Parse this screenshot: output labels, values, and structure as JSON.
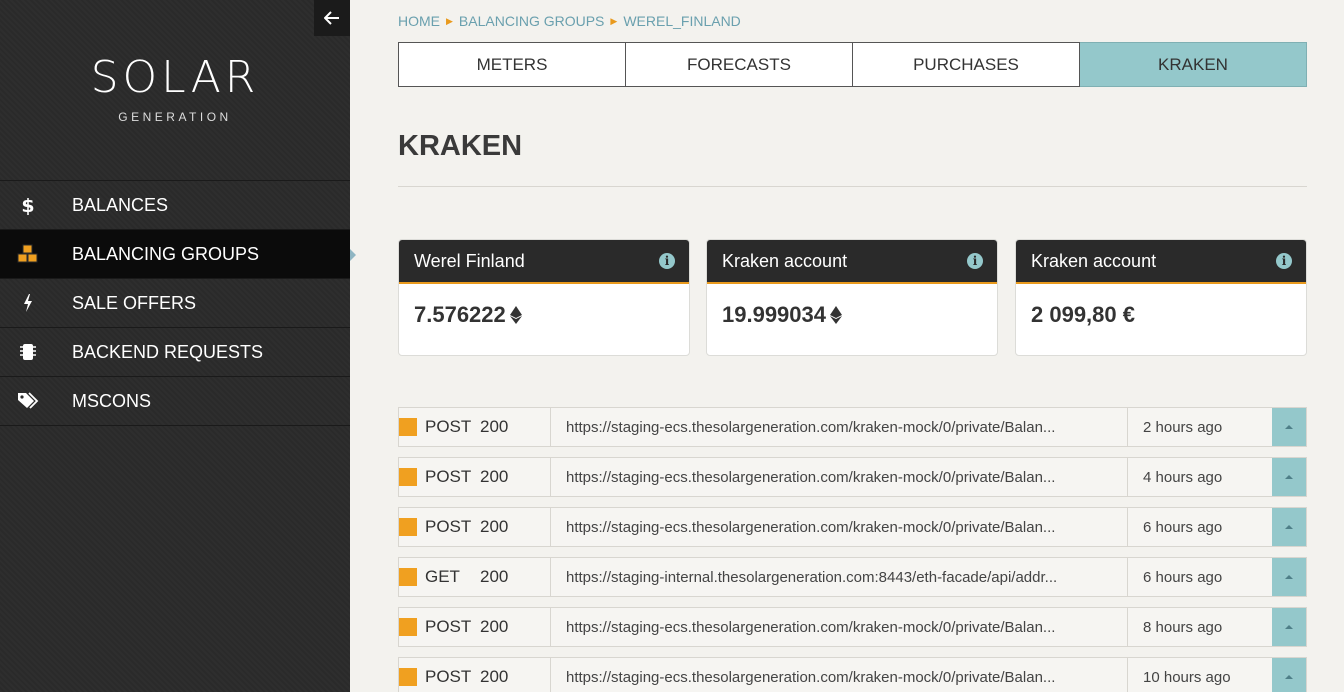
{
  "sidebar": {
    "logo_main": "SOLAR",
    "logo_sub": "GENERATION",
    "items": [
      {
        "label": "BALANCES",
        "icon": "dollar-icon"
      },
      {
        "label": "BALANCING GROUPS",
        "icon": "cubes-icon",
        "active": true
      },
      {
        "label": "SALE OFFERS",
        "icon": "bolt-icon"
      },
      {
        "label": "BACKEND REQUESTS",
        "icon": "chip-icon"
      },
      {
        "label": "MSCONS",
        "icon": "tags-icon"
      }
    ]
  },
  "breadcrumb": [
    "HOME",
    "BALANCING GROUPS",
    "WEREL_FINLAND"
  ],
  "tabs": [
    {
      "label": "METERS"
    },
    {
      "label": "FORECASTS"
    },
    {
      "label": "PURCHASES"
    },
    {
      "label": "KRAKEN",
      "active": true
    }
  ],
  "page_title": "KRAKEN",
  "cards": [
    {
      "title": "Werel Finland",
      "value": "7.576222",
      "unit_icon": "ethereum-icon"
    },
    {
      "title": "Kraken account",
      "value": "19.999034",
      "unit_icon": "ethereum-icon"
    },
    {
      "title": "Kraken account",
      "value": "2 099,80 €"
    }
  ],
  "requests": [
    {
      "method": "POST",
      "code": "200",
      "url": "https://staging-ecs.thesolargeneration.com/kraken-mock/0/private/Balan...",
      "time": "2 hours ago"
    },
    {
      "method": "POST",
      "code": "200",
      "url": "https://staging-ecs.thesolargeneration.com/kraken-mock/0/private/Balan...",
      "time": "4 hours ago"
    },
    {
      "method": "POST",
      "code": "200",
      "url": "https://staging-ecs.thesolargeneration.com/kraken-mock/0/private/Balan...",
      "time": "6 hours ago"
    },
    {
      "method": "GET",
      "code": "200",
      "url": "https://staging-internal.thesolargeneration.com:8443/eth-facade/api/addr...",
      "time": "6 hours ago"
    },
    {
      "method": "POST",
      "code": "200",
      "url": "https://staging-ecs.thesolargeneration.com/kraken-mock/0/private/Balan...",
      "time": "8 hours ago"
    },
    {
      "method": "POST",
      "code": "200",
      "url": "https://staging-ecs.thesolargeneration.com/kraken-mock/0/private/Balan...",
      "time": "10 hours ago"
    }
  ],
  "colors": {
    "accent": "#94c8cb",
    "orange": "#f0a020",
    "sidebar": "#2e2e2e",
    "link": "#6aa0ae"
  }
}
